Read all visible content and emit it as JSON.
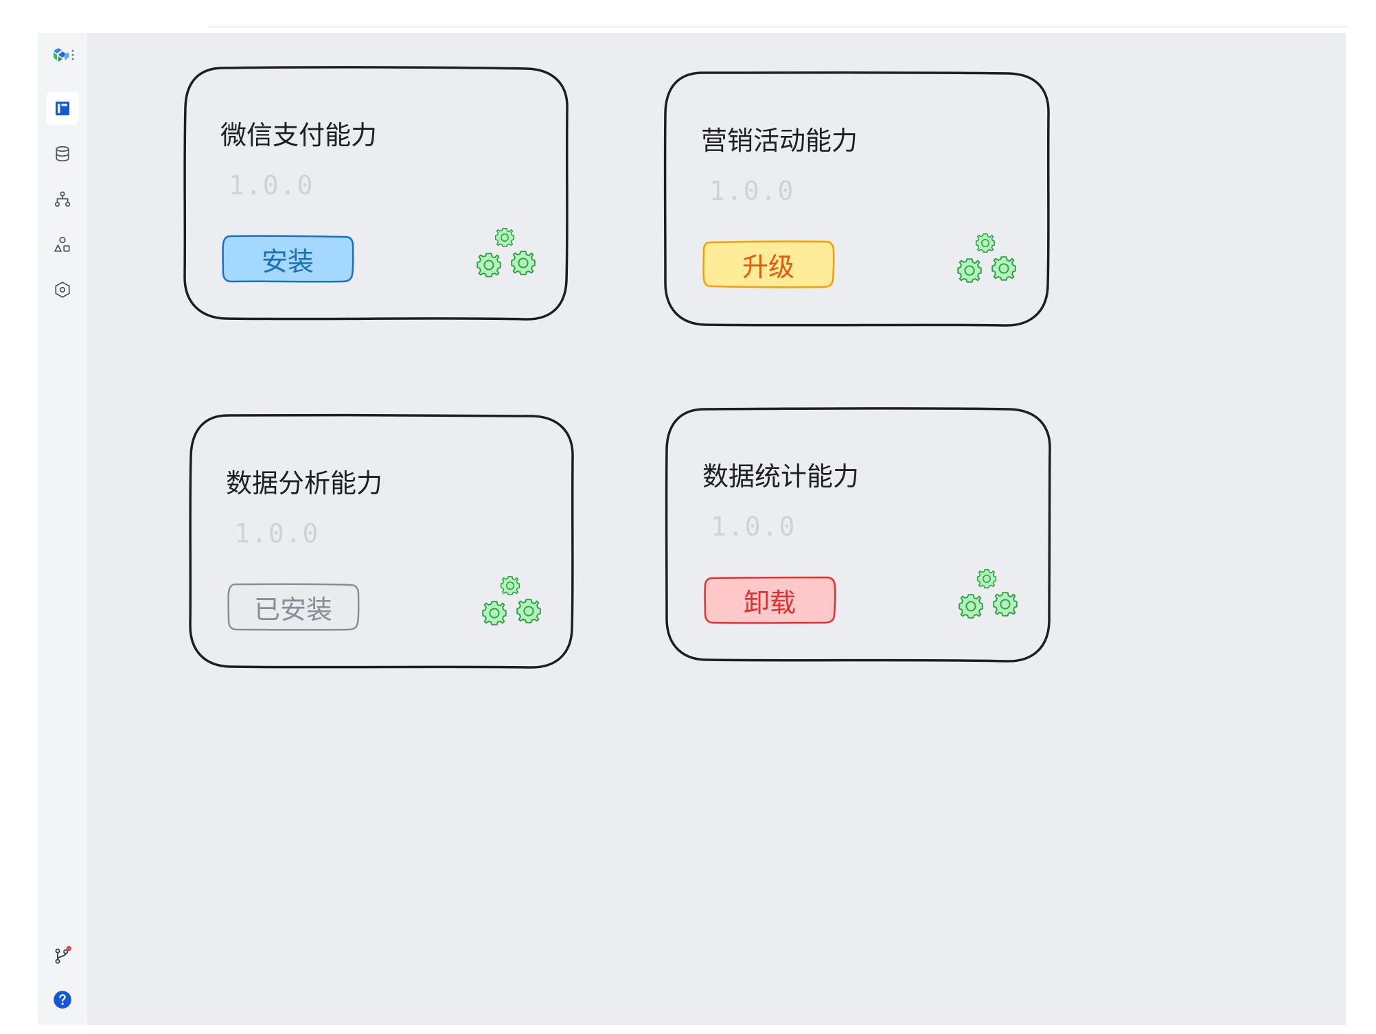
{
  "sidebar": {
    "logo_icon": "app-logo-icon",
    "items": [
      {
        "icon": "layout-icon",
        "active": true
      },
      {
        "icon": "database-icon",
        "active": false
      },
      {
        "icon": "hierarchy-icon",
        "active": false
      },
      {
        "icon": "shapes-icon",
        "active": false
      },
      {
        "icon": "hexagon-settings-icon",
        "active": false
      }
    ],
    "bottom_items": [
      {
        "icon": "git-branch-icon",
        "badge_color": "#e5484d"
      },
      {
        "icon": "help-icon",
        "color": "#1558d6"
      }
    ]
  },
  "cards": [
    {
      "title": "微信支付能力",
      "version": "1.0.0",
      "button": {
        "label": "安装",
        "text_color": "#1a6fb5",
        "fill": "#a5d8ff",
        "stroke": "#1971c2"
      }
    },
    {
      "title": "营销活动能力",
      "version": "1.0.0",
      "button": {
        "label": "升级",
        "text_color": "#e8590c",
        "fill": "#ffec99",
        "stroke": "#f59f00"
      }
    },
    {
      "title": "数据分析能力",
      "version": "1.0.0",
      "button": {
        "label": "已安装",
        "text_color": "#868e96",
        "fill": "#e9ecef",
        "stroke": "#868e96"
      }
    },
    {
      "title": "数据统计能力",
      "version": "1.0.0",
      "button": {
        "label": "卸载",
        "text_color": "#e03131",
        "fill": "#ffc9c9",
        "stroke": "#e03131"
      }
    }
  ],
  "colors": {
    "gear_fill": "#b2f2bb",
    "gear_stroke": "#2f9e44",
    "accent": "#1558d6"
  }
}
